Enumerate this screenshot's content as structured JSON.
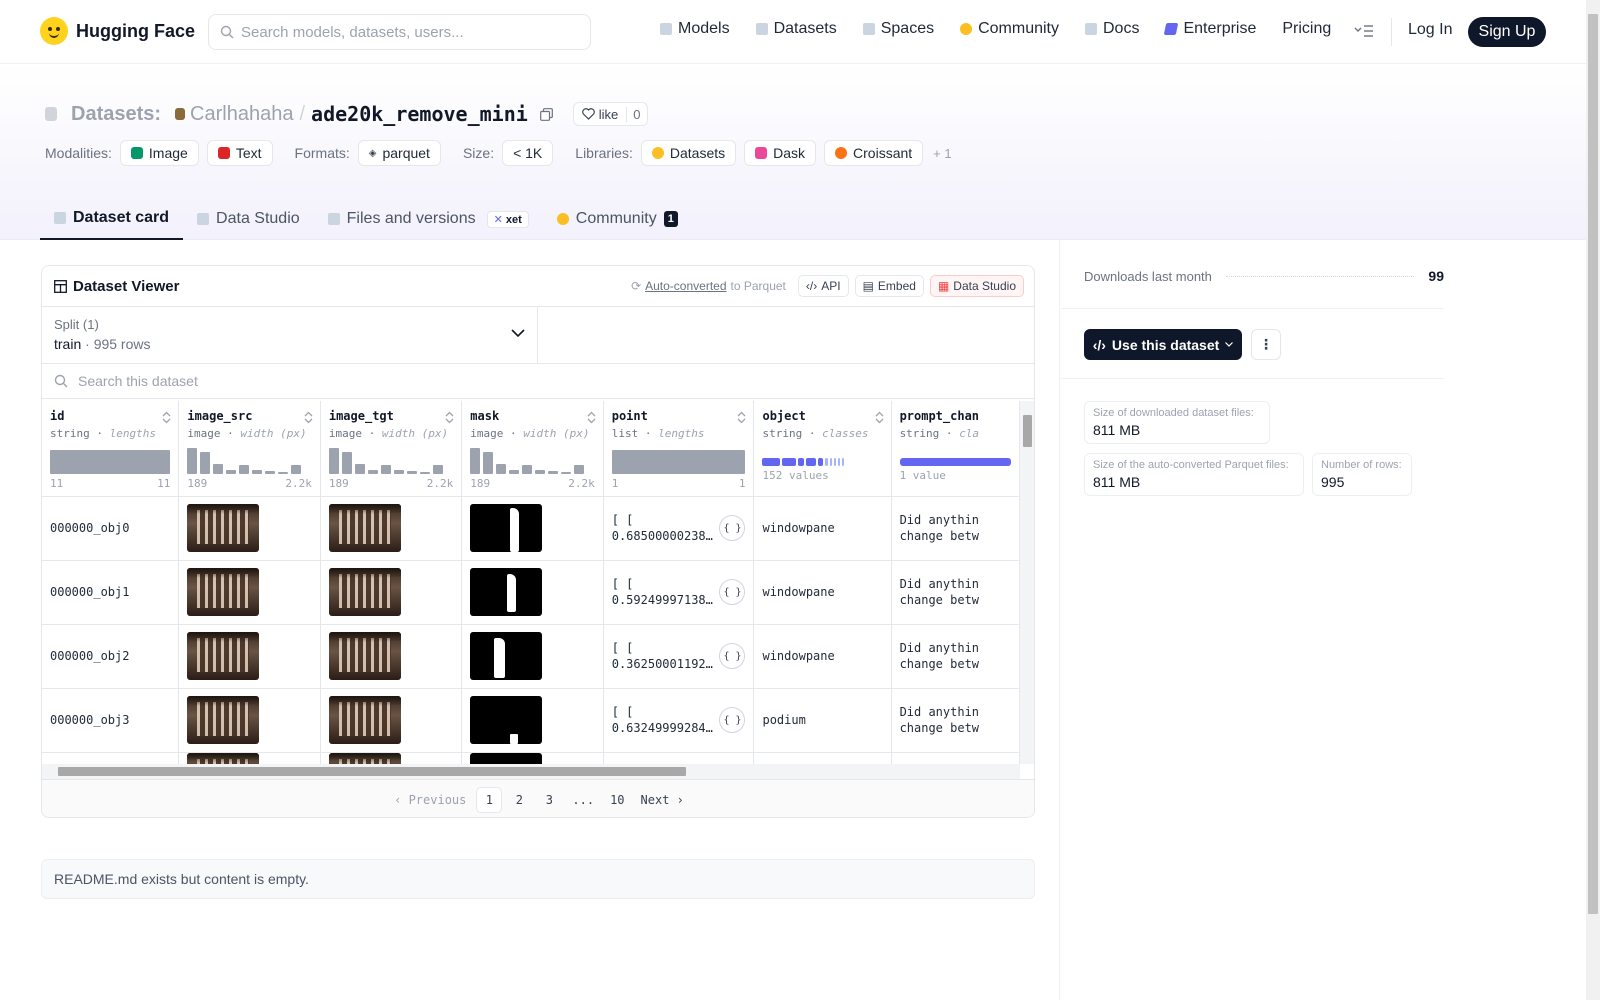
{
  "header": {
    "brand": "Hugging Face",
    "search_placeholder": "Search models, datasets, users...",
    "nav": [
      "Models",
      "Datasets",
      "Spaces",
      "Community",
      "Docs",
      "Enterprise",
      "Pricing"
    ],
    "login": "Log In",
    "signup": "Sign Up"
  },
  "repo": {
    "kind": "Datasets:",
    "owner": "Carlhahaha",
    "separator": "/",
    "name": "ade20k_remove_mini",
    "like_label": "like",
    "like_count": "0",
    "modalities_label": "Modalities:",
    "modalities": [
      "Image",
      "Text"
    ],
    "formats_label": "Formats:",
    "format": "parquet",
    "size_label": "Size:",
    "size": "< 1K",
    "libraries_label": "Libraries:",
    "libraries": [
      "Datasets",
      "Dask",
      "Croissant"
    ],
    "libraries_more": "+ 1"
  },
  "tabs": {
    "dataset_card": "Dataset card",
    "data_studio": "Data Studio",
    "files": "Files and versions",
    "xet": "xet",
    "community": "Community",
    "community_count": "1"
  },
  "viewer": {
    "title": "Dataset Viewer",
    "auto_converted": "Auto-converted",
    "to_parquet": "to Parquet",
    "api": "API",
    "embed": "Embed",
    "data_studio": "Data Studio",
    "split_label": "Split (1)",
    "split_name": "train",
    "split_sep": "·",
    "split_rows": "995 rows",
    "search_placeholder": "Search this dataset",
    "columns": [
      {
        "name": "id",
        "type": "string",
        "stat": "lengths",
        "min": "11",
        "max": "11"
      },
      {
        "name": "image_src",
        "type": "image",
        "stat": "width (px)",
        "min": "189",
        "max": "2.2k"
      },
      {
        "name": "image_tgt",
        "type": "image",
        "stat": "width (px)",
        "min": "189",
        "max": "2.2k"
      },
      {
        "name": "mask",
        "type": "image",
        "stat": "width (px)",
        "min": "189",
        "max": "2.2k"
      },
      {
        "name": "point",
        "type": "list",
        "stat": "lengths",
        "min": "1",
        "max": "1"
      },
      {
        "name": "object",
        "type": "string",
        "stat": "classes",
        "summary": "152 values"
      },
      {
        "name": "prompt_chan",
        "type": "string",
        "stat": "cla",
        "summary": "1 value"
      }
    ],
    "rows": [
      {
        "id": "000000_obj0",
        "point_l1": "[ [",
        "point_l2": "0.68500000238…",
        "object": "windowpane",
        "prompt_l1": "Did anythin",
        "prompt_l2": "change betw"
      },
      {
        "id": "000000_obj1",
        "point_l1": "[ [",
        "point_l2": "0.59249997138…",
        "object": "windowpane",
        "prompt_l1": "Did anythin",
        "prompt_l2": "change betw"
      },
      {
        "id": "000000_obj2",
        "point_l1": "[ [",
        "point_l2": "0.36250001192…",
        "object": "windowpane",
        "prompt_l1": "Did anythin",
        "prompt_l2": "change betw"
      },
      {
        "id": "000000_obj3",
        "point_l1": "[ [",
        "point_l2": "0.63249999284…",
        "object": "podium",
        "prompt_l1": "Did anythin",
        "prompt_l2": "change betw"
      }
    ],
    "pager": {
      "prev": "Previous",
      "pages": [
        "1",
        "2",
        "3",
        "...",
        "10"
      ],
      "next": "Next"
    }
  },
  "readme": "README.md exists but content is empty.",
  "sidebar": {
    "downloads_label": "Downloads last month",
    "downloads": "99",
    "use_button": "Use this dataset",
    "more": "⋮",
    "stats": [
      {
        "label": "Size of downloaded dataset files:",
        "value": "811 MB"
      },
      {
        "label": "Size of the auto-converted Parquet files:",
        "value": "811 MB"
      },
      {
        "label": "Number of rows:",
        "value": "995"
      }
    ]
  },
  "colors": {
    "accent": "#6366f1",
    "dark": "#0f172a",
    "brand_yellow": "#ffd21e"
  }
}
